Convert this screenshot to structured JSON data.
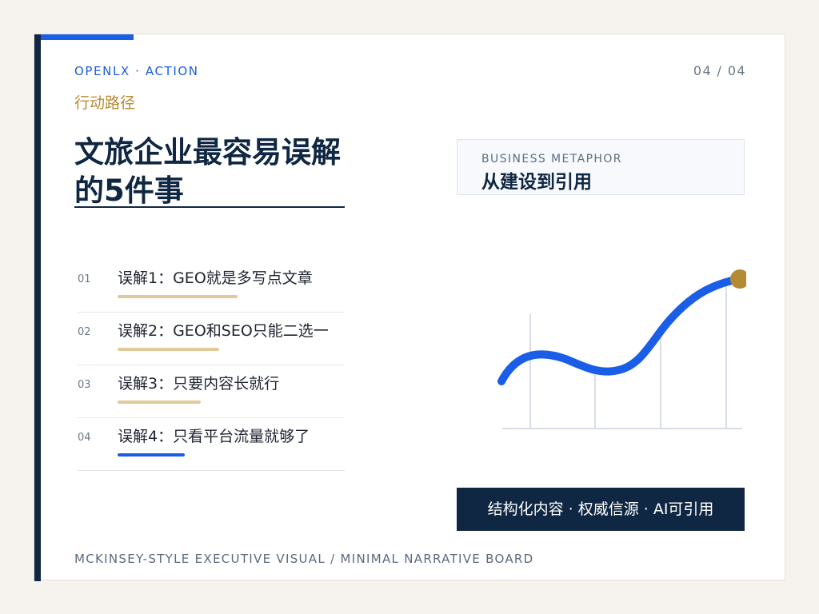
{
  "header": {
    "brand": "OPENLX · ACTION",
    "page_num": "04 / 04",
    "subtitle": "行动路径",
    "title_line1": "文旅企业最容易误解",
    "title_line2": "的5件事"
  },
  "list": [
    {
      "num": "01",
      "text": "误解1：GEO就是多写点文章",
      "accent": "gold",
      "fill": 0.45
    },
    {
      "num": "02",
      "text": "误解2：GEO和SEO只能二选一",
      "accent": "gold",
      "fill": 0.38
    },
    {
      "num": "03",
      "text": "误解3：只要内容长就行",
      "accent": "gold",
      "fill": 0.31
    },
    {
      "num": "04",
      "text": "误解4：只看平台流量就够了",
      "accent": "blue",
      "fill": 0.25
    }
  ],
  "metaphor": {
    "en": "BUSINESS METAPHOR",
    "cn": "从建设到引用"
  },
  "banner": {
    "text": "结构化内容 · 权威信源 · AI可引用"
  },
  "footer": {
    "text": "MCKINSEY-STYLE EXECUTIVE VISUAL / MINIMAL NARRATIVE BOARD"
  },
  "colors": {
    "navy": "#0f2742",
    "blue": "#1a5de6",
    "gold": "#b58a36",
    "gold_light": "#e2c99a",
    "curve": "#1a5de6",
    "dot": "#b58a36"
  },
  "icons": {
    "chart": "line-chart-icon"
  }
}
